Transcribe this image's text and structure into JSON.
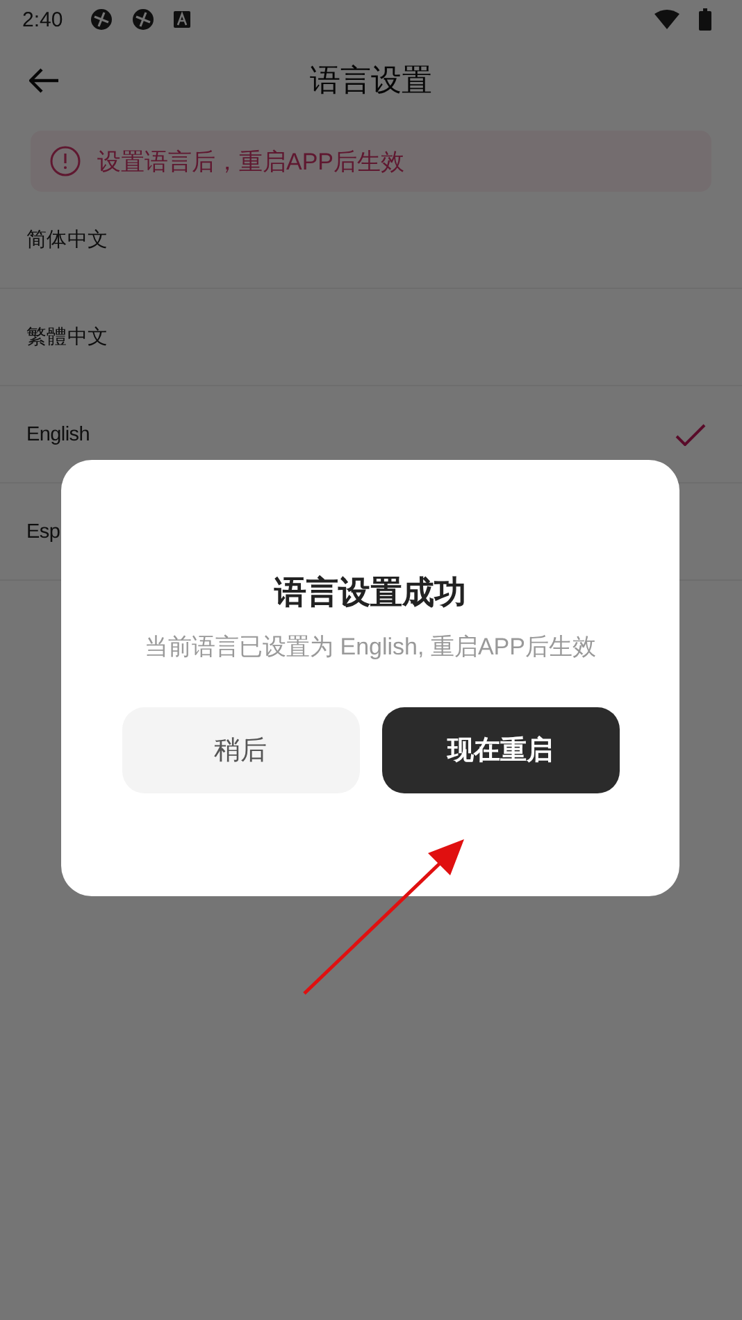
{
  "status_bar": {
    "time": "2:40"
  },
  "header": {
    "title": "语言设置"
  },
  "notice": {
    "text": "设置语言后，重启APP后生效"
  },
  "languages": [
    {
      "label": "简体中文",
      "selected": false
    },
    {
      "label": "繁體中文",
      "selected": false
    },
    {
      "label": "English",
      "selected": true
    },
    {
      "label": "Esp",
      "selected": false
    }
  ],
  "dialog": {
    "title": "语言设置成功",
    "message": "当前语言已设置为 English, 重启APP后生效",
    "buttons": [
      {
        "label": "稍后",
        "kind": "secondary"
      },
      {
        "label": "现在重启",
        "kind": "primary"
      }
    ]
  }
}
